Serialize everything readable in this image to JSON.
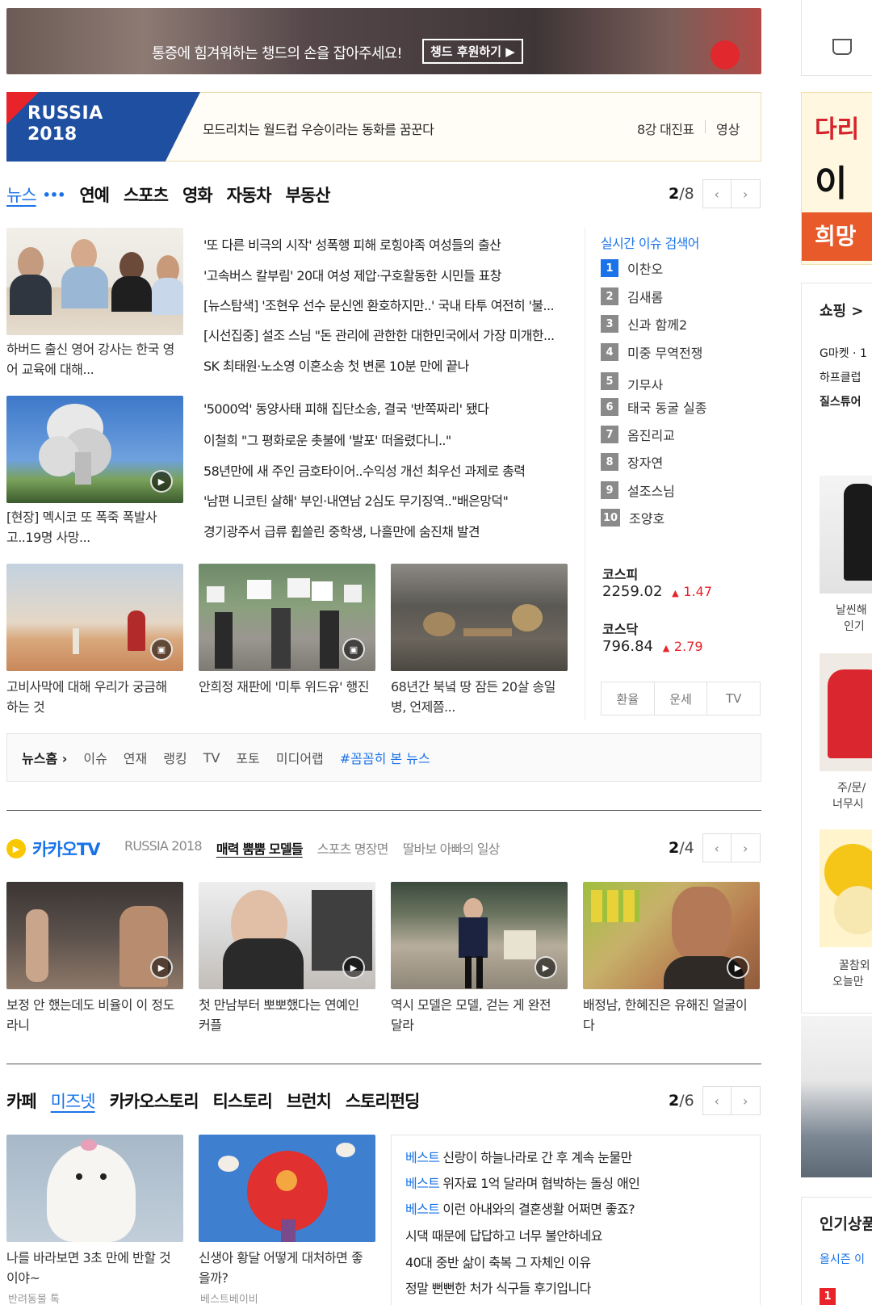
{
  "banner": {
    "text": "통증에 힘겨워하는 챙드의 손을 잡아주세요!",
    "button": "챙드 후원하기 ▶"
  },
  "worldcup": {
    "logo_line1": "RUSSIA",
    "logo_line2": "2018",
    "headline": "모드리치는 월드컵 우승이라는 동화를 꿈꾼다",
    "link1": "8강 대진표",
    "link2": "영상"
  },
  "news": {
    "tabs": [
      "뉴스",
      "연예",
      "스포츠",
      "영화",
      "자동차",
      "부동산"
    ],
    "page": "2",
    "total": "/8",
    "photos": [
      {
        "caption": "하버드 출신 영어 강사는 한국 영어 교육에 대해..."
      },
      {
        "caption": "[현장] 멕시코 또 폭죽 폭발사고..19명 사망..."
      },
      {
        "caption": "고비사막에 대해 우리가 궁금해 하는 것"
      },
      {
        "caption": "안희정 재판에 '미투 위드유' 행진"
      },
      {
        "caption": "68년간 북녘 땅 잠든 20살 송일병, 언제쯤..."
      }
    ],
    "headlines": [
      "'또 다른 비극의 시작' 성폭행 피해 로힝야족 여성들의 출산",
      "'고속버스 칼부림' 20대 여성 제압·구호활동한 시민들 표창",
      "[뉴스탐색] '조현우 선수 문신엔 환호하지만..' 국내 타투 여전히 '불...",
      "[시선집중] 설조 스님 \"돈 관리에 관한한 대한민국에서 가장 미개한...",
      "SK 최태원·노소영 이혼소송 첫 변론 10분 만에 끝나",
      "'5000억' 동양사태 피해 집단소송, 결국 '반쪽짜리' 됐다",
      "이철희 \"그 평화로운 촛불에 '발포' 떠올렸다니..\"",
      "58년만에 새 주인 금호타이어..수익성 개선 최우선 과제로 총력",
      "'남편 니코틴 살해' 부인·내연남 2심도 무기징역..\"배은망덕\"",
      "경기광주서 급류 휩쓸린 중학생, 나흘만에 숨진채 발견"
    ]
  },
  "realtime": {
    "title": "실시간 이슈 검색어",
    "items": [
      {
        "no": "1",
        "term": "이찬오"
      },
      {
        "no": "2",
        "term": "김새롬"
      },
      {
        "no": "3",
        "term": "신과 함께2"
      },
      {
        "no": "4",
        "term": "미중 무역전쟁"
      },
      {
        "no": "5",
        "term": "기무사"
      },
      {
        "no": "6",
        "term": "태국 동굴 실종"
      },
      {
        "no": "7",
        "term": "옴진리교"
      },
      {
        "no": "8",
        "term": "장자연"
      },
      {
        "no": "9",
        "term": "설조스님"
      },
      {
        "no": "10",
        "term": "조양호"
      }
    ]
  },
  "market": {
    "kospi_label": "코스피",
    "kospi_value": "2259.02",
    "kospi_change": "1.47",
    "kosdaq_label": "코스닥",
    "kosdaq_value": "796.84",
    "kosdaq_change": "2.79",
    "rise_color": "#e8232a",
    "tabs": [
      "환율",
      "운세",
      "TV"
    ]
  },
  "newsnav": {
    "home": "뉴스홈",
    "items": [
      "이슈",
      "연재",
      "랭킹",
      "TV",
      "포토",
      "미디어랩"
    ],
    "highlight": "#꼼꼼히 본 뉴스"
  },
  "kakaotv": {
    "title": "카카오TV",
    "tabs": [
      "RUSSIA 2018",
      "매력 뿜뿜 모델들",
      "스포츠 명장면",
      "딸바보 아빠의 일상"
    ],
    "page": "2",
    "total": "/4",
    "videos": [
      {
        "caption": "보정 안 했는데도 비율이 이 정도라니"
      },
      {
        "caption": "첫 만남부터 뽀뽀했다는 연예인 커플"
      },
      {
        "caption": "역시 모델은 모델, 걷는 게 완전 달라"
      },
      {
        "caption": "배정남, 한혜진은 유해진 얼굴이다"
      }
    ]
  },
  "cafe": {
    "tabs": [
      "카페",
      "미즈넷",
      "카카오스토리",
      "티스토리",
      "브런치",
      "스토리펀딩"
    ],
    "page": "2",
    "total": "/6",
    "photos": [
      {
        "caption": "나를 바라보면 3초 만에 반할 것이야~",
        "source": "반려동물 톡"
      },
      {
        "caption": "신생아 황달 어떻게 대처하면 좋을까?",
        "source": "베스트베이비"
      }
    ],
    "best_tag": "베스트",
    "lines": [
      {
        "best": true,
        "text": "신랑이 하늘나라로 간 후 계속 눈물만"
      },
      {
        "best": true,
        "text": "위자료 1억 달라며 협박하는 돌싱 애인"
      },
      {
        "best": true,
        "text": "이런 아내와의 결혼생활 어쩌면 좋죠?"
      },
      {
        "best": false,
        "text": "시댁 때문에 답답하고 너무 불안하네요"
      },
      {
        "best": false,
        "text": "40대 중반 삶이 축복 그 자체인 이유"
      },
      {
        "best": false,
        "text": "정말 뻔뻔한 처가 식구들 후기입니다"
      }
    ]
  },
  "sidebar": {
    "ad_line1": "다리",
    "ad_line2": "이",
    "ad_btn": "희망",
    "shopping_title": "쇼핑 >",
    "shop_links": [
      "G마켓 · 1",
      "하프클럽",
      "질스튜어"
    ],
    "shop_caps": [
      "날씬해",
      "인기",
      "주/문/",
      "너무시",
      "꿀참외",
      "오늘만"
    ],
    "popular_title": "인기상품",
    "popular_sub": "올시즌 이",
    "popular_rank": "1"
  },
  "colors": {
    "accent": "#1a73e8",
    "kakao_yellow": "#f9c700",
    "rise": "#e8232a"
  }
}
